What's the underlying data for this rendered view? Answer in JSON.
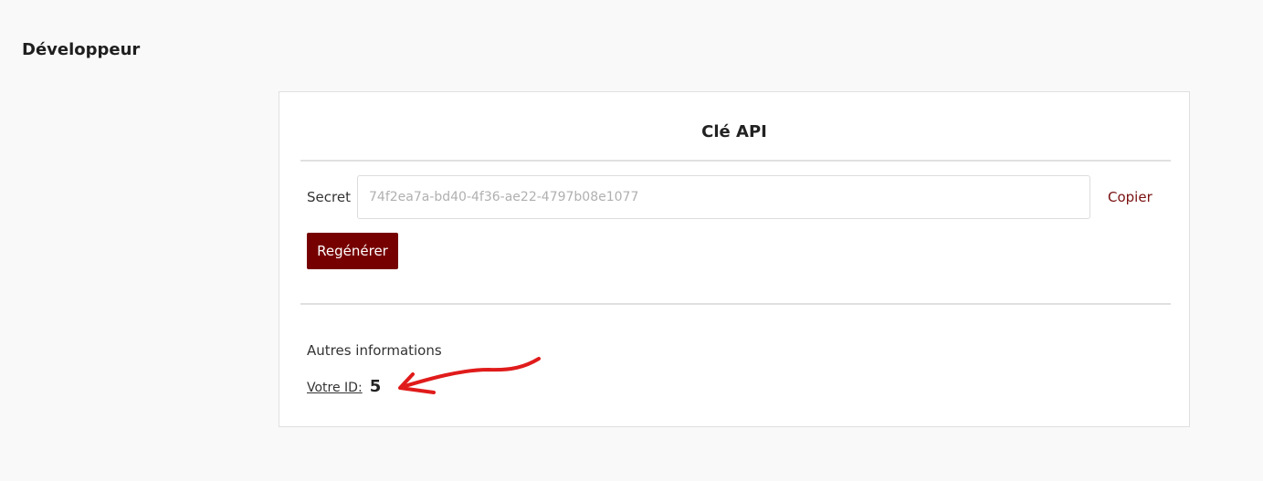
{
  "page": {
    "title": "Développeur"
  },
  "card": {
    "title": "Clé API",
    "secret": {
      "label": "Secret",
      "value": "74f2ea7a-bd40-4f36-ae22-4797b08e1077",
      "copy_label": "Copier"
    },
    "regenerate_label": "Regénérer",
    "other": {
      "title": "Autres informations",
      "id_label": "Votre ID:",
      "id_value": "5"
    }
  },
  "colors": {
    "accent": "#760000",
    "copy_link": "#7a1010",
    "annotation_arrow": "#e01b1b",
    "background": "#f9f9f9"
  },
  "icons": {
    "annotation": "red-arrow-annotation"
  }
}
